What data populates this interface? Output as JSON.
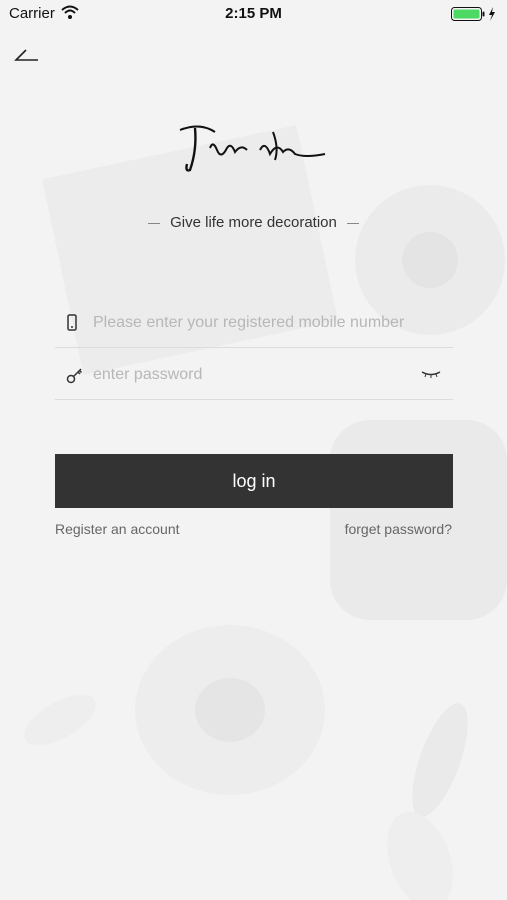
{
  "status_bar": {
    "carrier": "Carrier",
    "time": "2:15 PM"
  },
  "logo_text": "First Love",
  "tagline": "Give life more decoration",
  "phone_field": {
    "placeholder": "Please enter your registered mobile number",
    "value": ""
  },
  "password_field": {
    "placeholder": "enter password",
    "value": ""
  },
  "login_button": "log in",
  "register_link": "Register an account",
  "forgot_link": "forget password?",
  "colors": {
    "button_bg": "#333333",
    "button_text": "#ffffff",
    "background": "#f4f4f4",
    "divider": "#dcdcdc"
  },
  "icons": [
    "wifi-icon",
    "battery-icon",
    "charging-icon",
    "back-arrow-icon",
    "phone-icon",
    "key-icon",
    "eye-closed-icon"
  ]
}
